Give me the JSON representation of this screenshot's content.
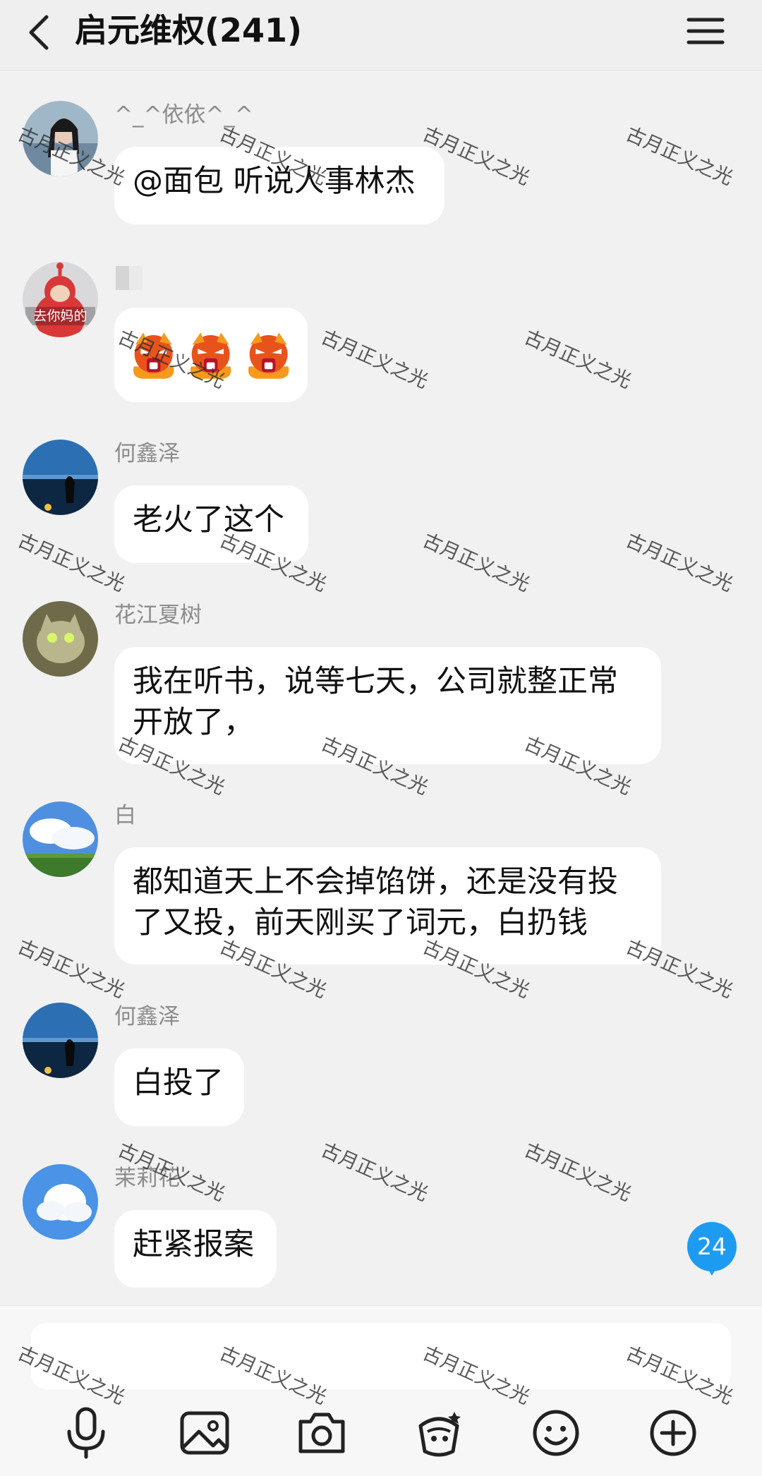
{
  "header": {
    "title": "启元维权(241)",
    "back_icon": "chevron-left-icon",
    "menu_icon": "hamburger-menu-icon"
  },
  "messages": [
    {
      "sender": "^_^依依^_^",
      "text": "@面包 听说人事林杰"
    },
    {
      "sender": "",
      "text": "",
      "emoji": "angry-face-emoji x3"
    },
    {
      "sender": "何鑫泽",
      "text": "老火了这个"
    },
    {
      "sender": "花江夏树",
      "lines": [
        "我在听书，说等七天，公司就整正常",
        "开放了，"
      ]
    },
    {
      "sender": "白",
      "lines": [
        "都知道天上不会掉馅饼，还是没有投",
        "了又投，前天刚买了词元，白扔钱"
      ]
    },
    {
      "sender": "何鑫泽",
      "text": "白投了"
    },
    {
      "sender": "茉莉花",
      "text": "赶紧报案"
    }
  ],
  "avatar_texts": {
    "teletubby": "去你妈的"
  },
  "unread_badge": "24",
  "toolbar": {
    "icons": [
      "microphone-icon",
      "image-icon",
      "camera-icon",
      "red-packet-icon",
      "smiley-icon",
      "plus-circle-icon"
    ]
  },
  "watermark": "古月正义之光",
  "colors": {
    "accent": "#1d9bf0",
    "bubble": "#ffffff",
    "background": "#f1f1f1"
  }
}
